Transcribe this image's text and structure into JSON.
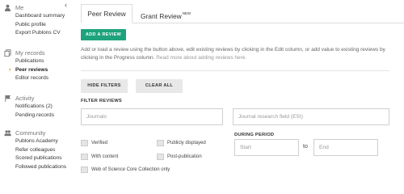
{
  "sidebar": {
    "collapse_glyph": "‹",
    "sections": [
      {
        "title": "Me",
        "icon": "person-icon",
        "items": [
          "Dashboard summary",
          "Public profile",
          "Export Publons CV"
        ]
      },
      {
        "title": "My records",
        "icon": "records-icon",
        "items": [
          "Publications",
          "Peer reviews",
          "Editor records"
        ],
        "active_item": "Peer reviews"
      },
      {
        "title": "Activity",
        "icon": "flag-icon",
        "items": [
          "Notifications (2)",
          "Pending records"
        ]
      },
      {
        "title": "Community",
        "icon": "people-icon",
        "items": [
          "Publons Academy",
          "Refer colleagues",
          "Scored publications",
          "Followed publications"
        ]
      }
    ]
  },
  "tabs": {
    "peer_review": "Peer Review",
    "grant_review": "Grant Review",
    "new_badge": "NEW"
  },
  "actions": {
    "add_review": "ADD A REVIEW",
    "hide_filters": "HIDE FILTERS",
    "clear_all": "CLEAR ALL"
  },
  "description": {
    "text": "Add or load a review using the button above, edit existing reviews by clicking in the Edit column, or add value to existing reviews by clicking in the Progress column.",
    "link": "Read more about adding reviews here."
  },
  "filters": {
    "title": "FILTER REVIEWS",
    "journals_placeholder": "Journals",
    "research_field_placeholder": "Journal research field (ESI)",
    "during_period_label": "DURING PERIOD",
    "start_placeholder": "Start",
    "to_label": "to",
    "end_placeholder": "End",
    "checkboxes": {
      "verified": "Verified",
      "publicly_displayed": "Publicly displayed",
      "with_content": "With content",
      "post_publication": "Post-publication",
      "wos_core": "Web of Science Core Collection only"
    }
  },
  "colors": {
    "accent_green": "#1ea37c",
    "active_arrow": "#e07b00"
  }
}
